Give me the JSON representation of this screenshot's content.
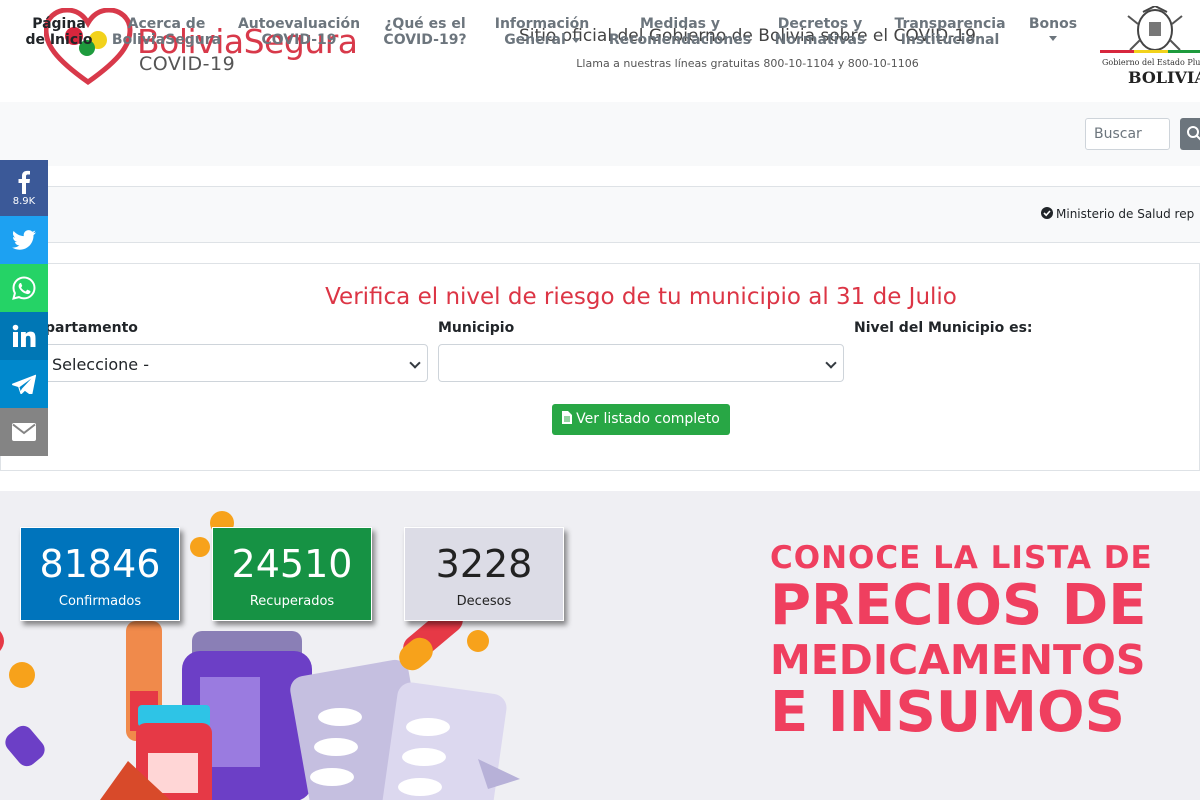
{
  "header": {
    "brand": "BoliviaSegura",
    "brand_sub": "COVID-19",
    "title": "Sitio oficial del Gobierno de Bolivia sobre el COVID-19",
    "phone_note": "Llama a nuestras líneas gratuitas 800-10-1104 y 800-10-1106",
    "gov_line1": "Gobierno del Estado Plurinacional",
    "gov_line2": "BOLIVIA"
  },
  "nav": {
    "items": [
      {
        "label": "Página de Inicio",
        "line1": "Página",
        "line2": "de Inicio",
        "active": true
      },
      {
        "label": "Acerca de BoliviaSegura",
        "line1": "Acerca de",
        "line2": "BoliviaSegura"
      },
      {
        "label": "Autoevaluación COVID-19",
        "line1": "Autoevaluación",
        "line2": "COVID-19"
      },
      {
        "label": "¿Qué es el COVID-19?",
        "line1": "¿Qué es el",
        "line2": "COVID-19?"
      },
      {
        "label": "Información General",
        "line1": "Información",
        "line2": "General",
        "dropdown": true
      },
      {
        "label": "Medidas y Recomendaciones",
        "line1": "Medidas y",
        "line2": "Recomendaciones"
      },
      {
        "label": "Decretos y Normativas",
        "line1": "Decretos y",
        "line2": "Normativas"
      },
      {
        "label": "Transparencia Institucional",
        "line1": "Transparencia",
        "line2": "Institucional"
      },
      {
        "label": "Bonos",
        "line1": "Bonos",
        "dropdown": true
      }
    ],
    "search_placeholder": "Buscar"
  },
  "ticker": {
    "text": "Ministerio de Salud rep"
  },
  "risk": {
    "title": "Verifica el nivel de riesgo de tu municipio al 31 de Julio",
    "departamento_label": "partamento",
    "departamento_value": "Seleccione -",
    "municipio_label": "Municipio",
    "municipio_value": "",
    "nivel_label": "Nivel del Municipio es:",
    "list_button": "Ver listado completo"
  },
  "stats": [
    {
      "value": "81846",
      "label": "Confirmados",
      "bg": "#0074bc",
      "fg": "#ffffff"
    },
    {
      "value": "24510",
      "label": "Recuperados",
      "bg": "#169244",
      "fg": "#ffffff"
    },
    {
      "value": "3228",
      "label": "Decesos",
      "bg": "#dcdce6",
      "fg": "#222222"
    }
  ],
  "promo": {
    "line1": "CONOCE LA LISTA DE",
    "line2": "PRECIOS DE",
    "line3": "MEDICAMENTOS",
    "line4": "E INSUMOS"
  },
  "social": [
    {
      "icon": "facebook-icon",
      "count": "8.9K",
      "color": "#3b5998"
    },
    {
      "icon": "twitter-icon",
      "color": "#1da1f2"
    },
    {
      "icon": "whatsapp-icon",
      "color": "#25d366"
    },
    {
      "icon": "linkedin-icon",
      "color": "#0077b5"
    },
    {
      "icon": "telegram-icon",
      "color": "#0088cc"
    },
    {
      "icon": "email-icon",
      "color": "#848484"
    }
  ]
}
